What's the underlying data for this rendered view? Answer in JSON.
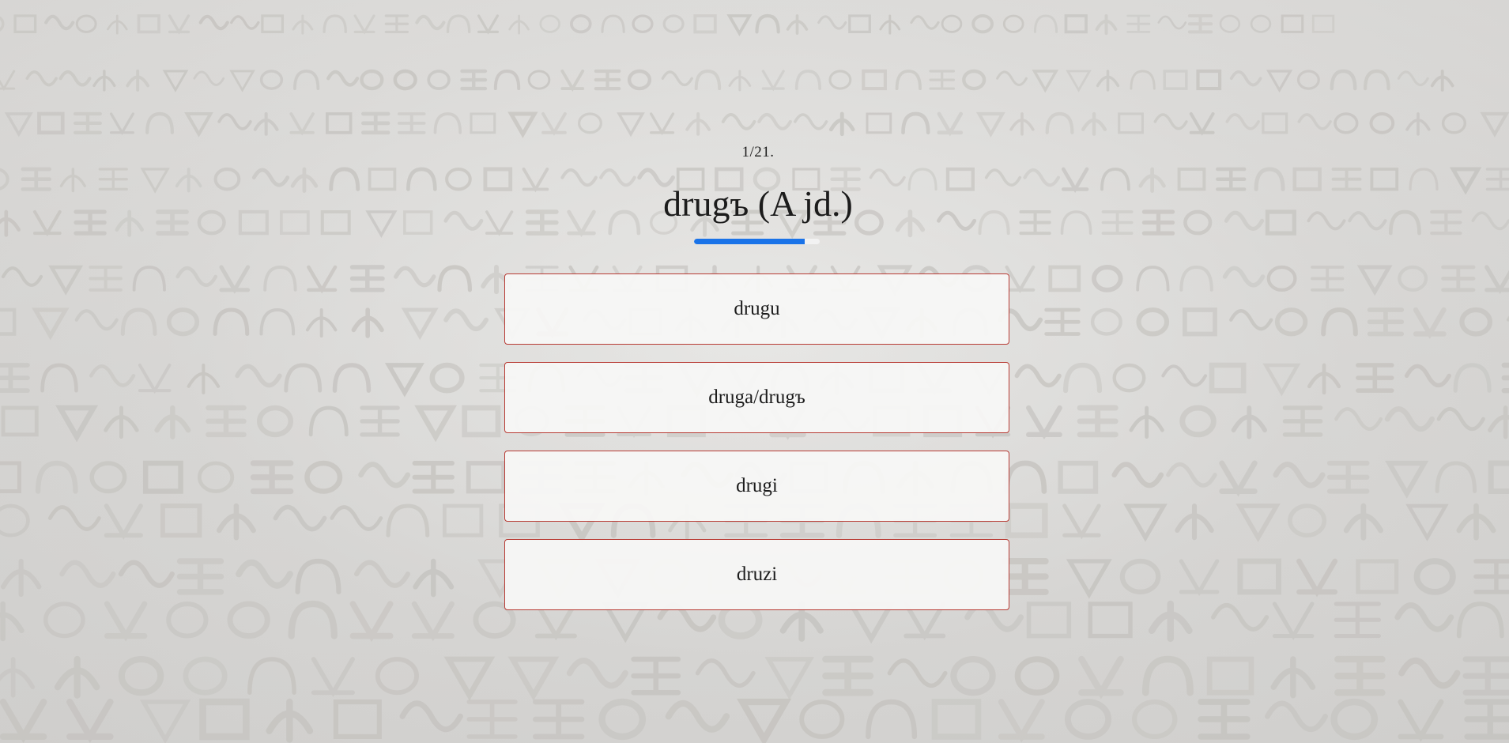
{
  "quiz": {
    "counter": "1/21.",
    "question": "drugъ (A jd.)",
    "progress": 0.88,
    "progress_color": "#1a73e8",
    "answers": [
      {
        "label": "drugu"
      },
      {
        "label": "druga/drugъ"
      },
      {
        "label": "drugi"
      },
      {
        "label": "druzi"
      }
    ]
  },
  "colors": {
    "answer_border": "#b83b34",
    "answer_bg": "#f7f7f6"
  },
  "background": {
    "description_icon": "glagolitic-stone-inscription"
  }
}
